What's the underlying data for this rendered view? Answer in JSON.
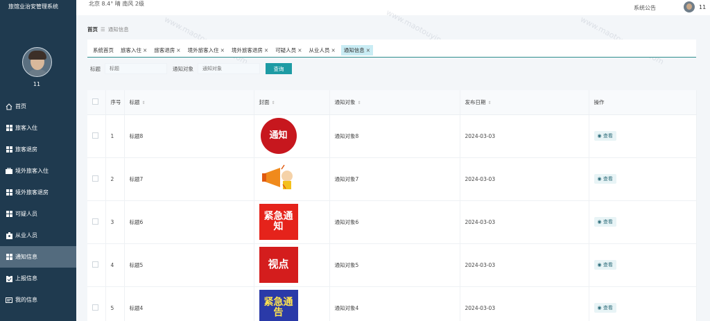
{
  "app": {
    "title": "旅馆业治安管理系统"
  },
  "topbar": {
    "weather": "北京  8.4°  晴  南风  2级",
    "notice": "系统公告",
    "user": "11"
  },
  "sidebar": {
    "username": "11",
    "items": [
      {
        "label": "首页",
        "icon": "home-icon"
      },
      {
        "label": "旅客入住",
        "icon": "grid-icon"
      },
      {
        "label": "旅客退房",
        "icon": "grid-icon"
      },
      {
        "label": "境外旅客入住",
        "icon": "briefcase-icon"
      },
      {
        "label": "境外旅客退房",
        "icon": "grid-icon"
      },
      {
        "label": "可疑人员",
        "icon": "grid-icon"
      },
      {
        "label": "从业人员",
        "icon": "badge-icon"
      },
      {
        "label": "通知信息",
        "icon": "grid-icon",
        "active": true
      },
      {
        "label": "上报信息",
        "icon": "clipboard-icon"
      },
      {
        "label": "我的信息",
        "icon": "card-icon"
      }
    ]
  },
  "breadcrumb": {
    "home": "首页",
    "sep": "☰",
    "current": "通知信息"
  },
  "tabs": [
    {
      "label": "系统首页",
      "closable": false
    },
    {
      "label": "旅客入住",
      "closable": true
    },
    {
      "label": "旅客退房",
      "closable": true
    },
    {
      "label": "境外旅客入住",
      "closable": true
    },
    {
      "label": "境外旅客退房",
      "closable": true
    },
    {
      "label": "可疑人员",
      "closable": true
    },
    {
      "label": "从业人员",
      "closable": true
    },
    {
      "label": "通知信息",
      "closable": true,
      "active": true
    }
  ],
  "search": {
    "title_label": "标题",
    "title_placeholder": "标题",
    "target_label": "通知对象",
    "target_placeholder": "通知对象",
    "button": "查询"
  },
  "table": {
    "headers": [
      "序号",
      "标题",
      "封面",
      "通知对象",
      "发布日期",
      "操作"
    ],
    "rows": [
      {
        "no": "1",
        "title": "标题8",
        "cover": "通知",
        "target": "通知对象8",
        "date": "2024-03-03",
        "action": "查看"
      },
      {
        "no": "2",
        "title": "标题7",
        "cover": "",
        "target": "通知对象7",
        "date": "2024-03-03",
        "action": "查看"
      },
      {
        "no": "3",
        "title": "标题6",
        "cover": "紧急通知",
        "target": "通知对象6",
        "date": "2024-03-03",
        "action": "查看"
      },
      {
        "no": "4",
        "title": "标题5",
        "cover": "视点",
        "target": "通知对象5",
        "date": "2024-03-03",
        "action": "查看"
      },
      {
        "no": "5",
        "title": "标题4",
        "cover": "紧急通告",
        "target": "通知对象4",
        "date": "2024-03-03",
        "action": "查看"
      }
    ]
  },
  "watermark": "www.maotouyingcc.com"
}
